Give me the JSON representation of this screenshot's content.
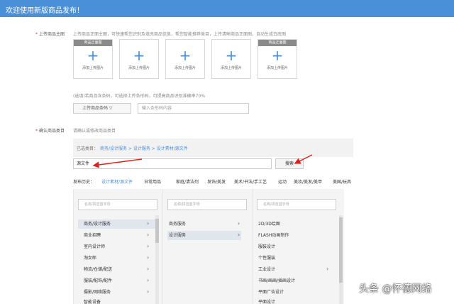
{
  "banner": {
    "title": "欢迎使用新版商品发布！"
  },
  "images": {
    "label": "上传商品主图",
    "hint": "上传商品正面主图，可快速帮您识别及填充商品信息，帮您智能推荐类目，上传清晰商品正面图，自动生成白底图",
    "slots": [
      {
        "tag": "商品正面图",
        "plus": "+",
        "label": "添加上传图片"
      },
      {
        "tag": "",
        "plus": "+",
        "label": "添加上传图片"
      },
      {
        "tag": "",
        "plus": "+",
        "label": "添加上传图片"
      },
      {
        "tag": "",
        "plus": "+",
        "label": "添加上传图片"
      },
      {
        "tag": "商品正面图",
        "plus": "+",
        "label": "添加上传图片"
      }
    ]
  },
  "barcode": {
    "hint": "(选填)若商品含条码，可选择上传条形码，可提高商品识别准确率70%",
    "select_label": "上传商品条码 ▽",
    "input_placeholder": "输入条形码内容"
  },
  "category": {
    "label": "确认商品类目",
    "hint": "请确认或修改商品类目",
    "chosen_label": "已选类目：",
    "chosen_value": "商务/设计服务 > 设计服务 > 设计素材/源文件",
    "search_value": "源文件",
    "search_button": "搜索",
    "history_label": "发布历史：",
    "history": [
      "设计素材/源文件",
      "日常用品",
      "家庭/清洁剂",
      "发饰/美发",
      "美术/书法/手工艺",
      "运动",
      "美妆/美发/美甲",
      "美国/玩具"
    ],
    "col1_placeholder": "名称/拼音首字母",
    "col2_placeholder": "名称/拼音首字母",
    "col3_placeholder": "名称/拼音首字母",
    "col1": [
      "商务/设计服务",
      "商业招聘",
      "室内设计师",
      "淘女郎",
      "物流/仓储/配送",
      "服装/配饰/配件",
      "摄影/网络服务",
      "智能设备"
    ],
    "col2": [
      "商务服务",
      "设计服务"
    ],
    "col3": [
      "2D/3D绘图",
      "FLASH动画制作",
      "服装设计",
      "个性服装",
      "工业设计",
      "书画/画画/插画设计",
      "平面广告设计",
      "平面设计"
    ]
  },
  "watermark": "头条 @怀德网络"
}
